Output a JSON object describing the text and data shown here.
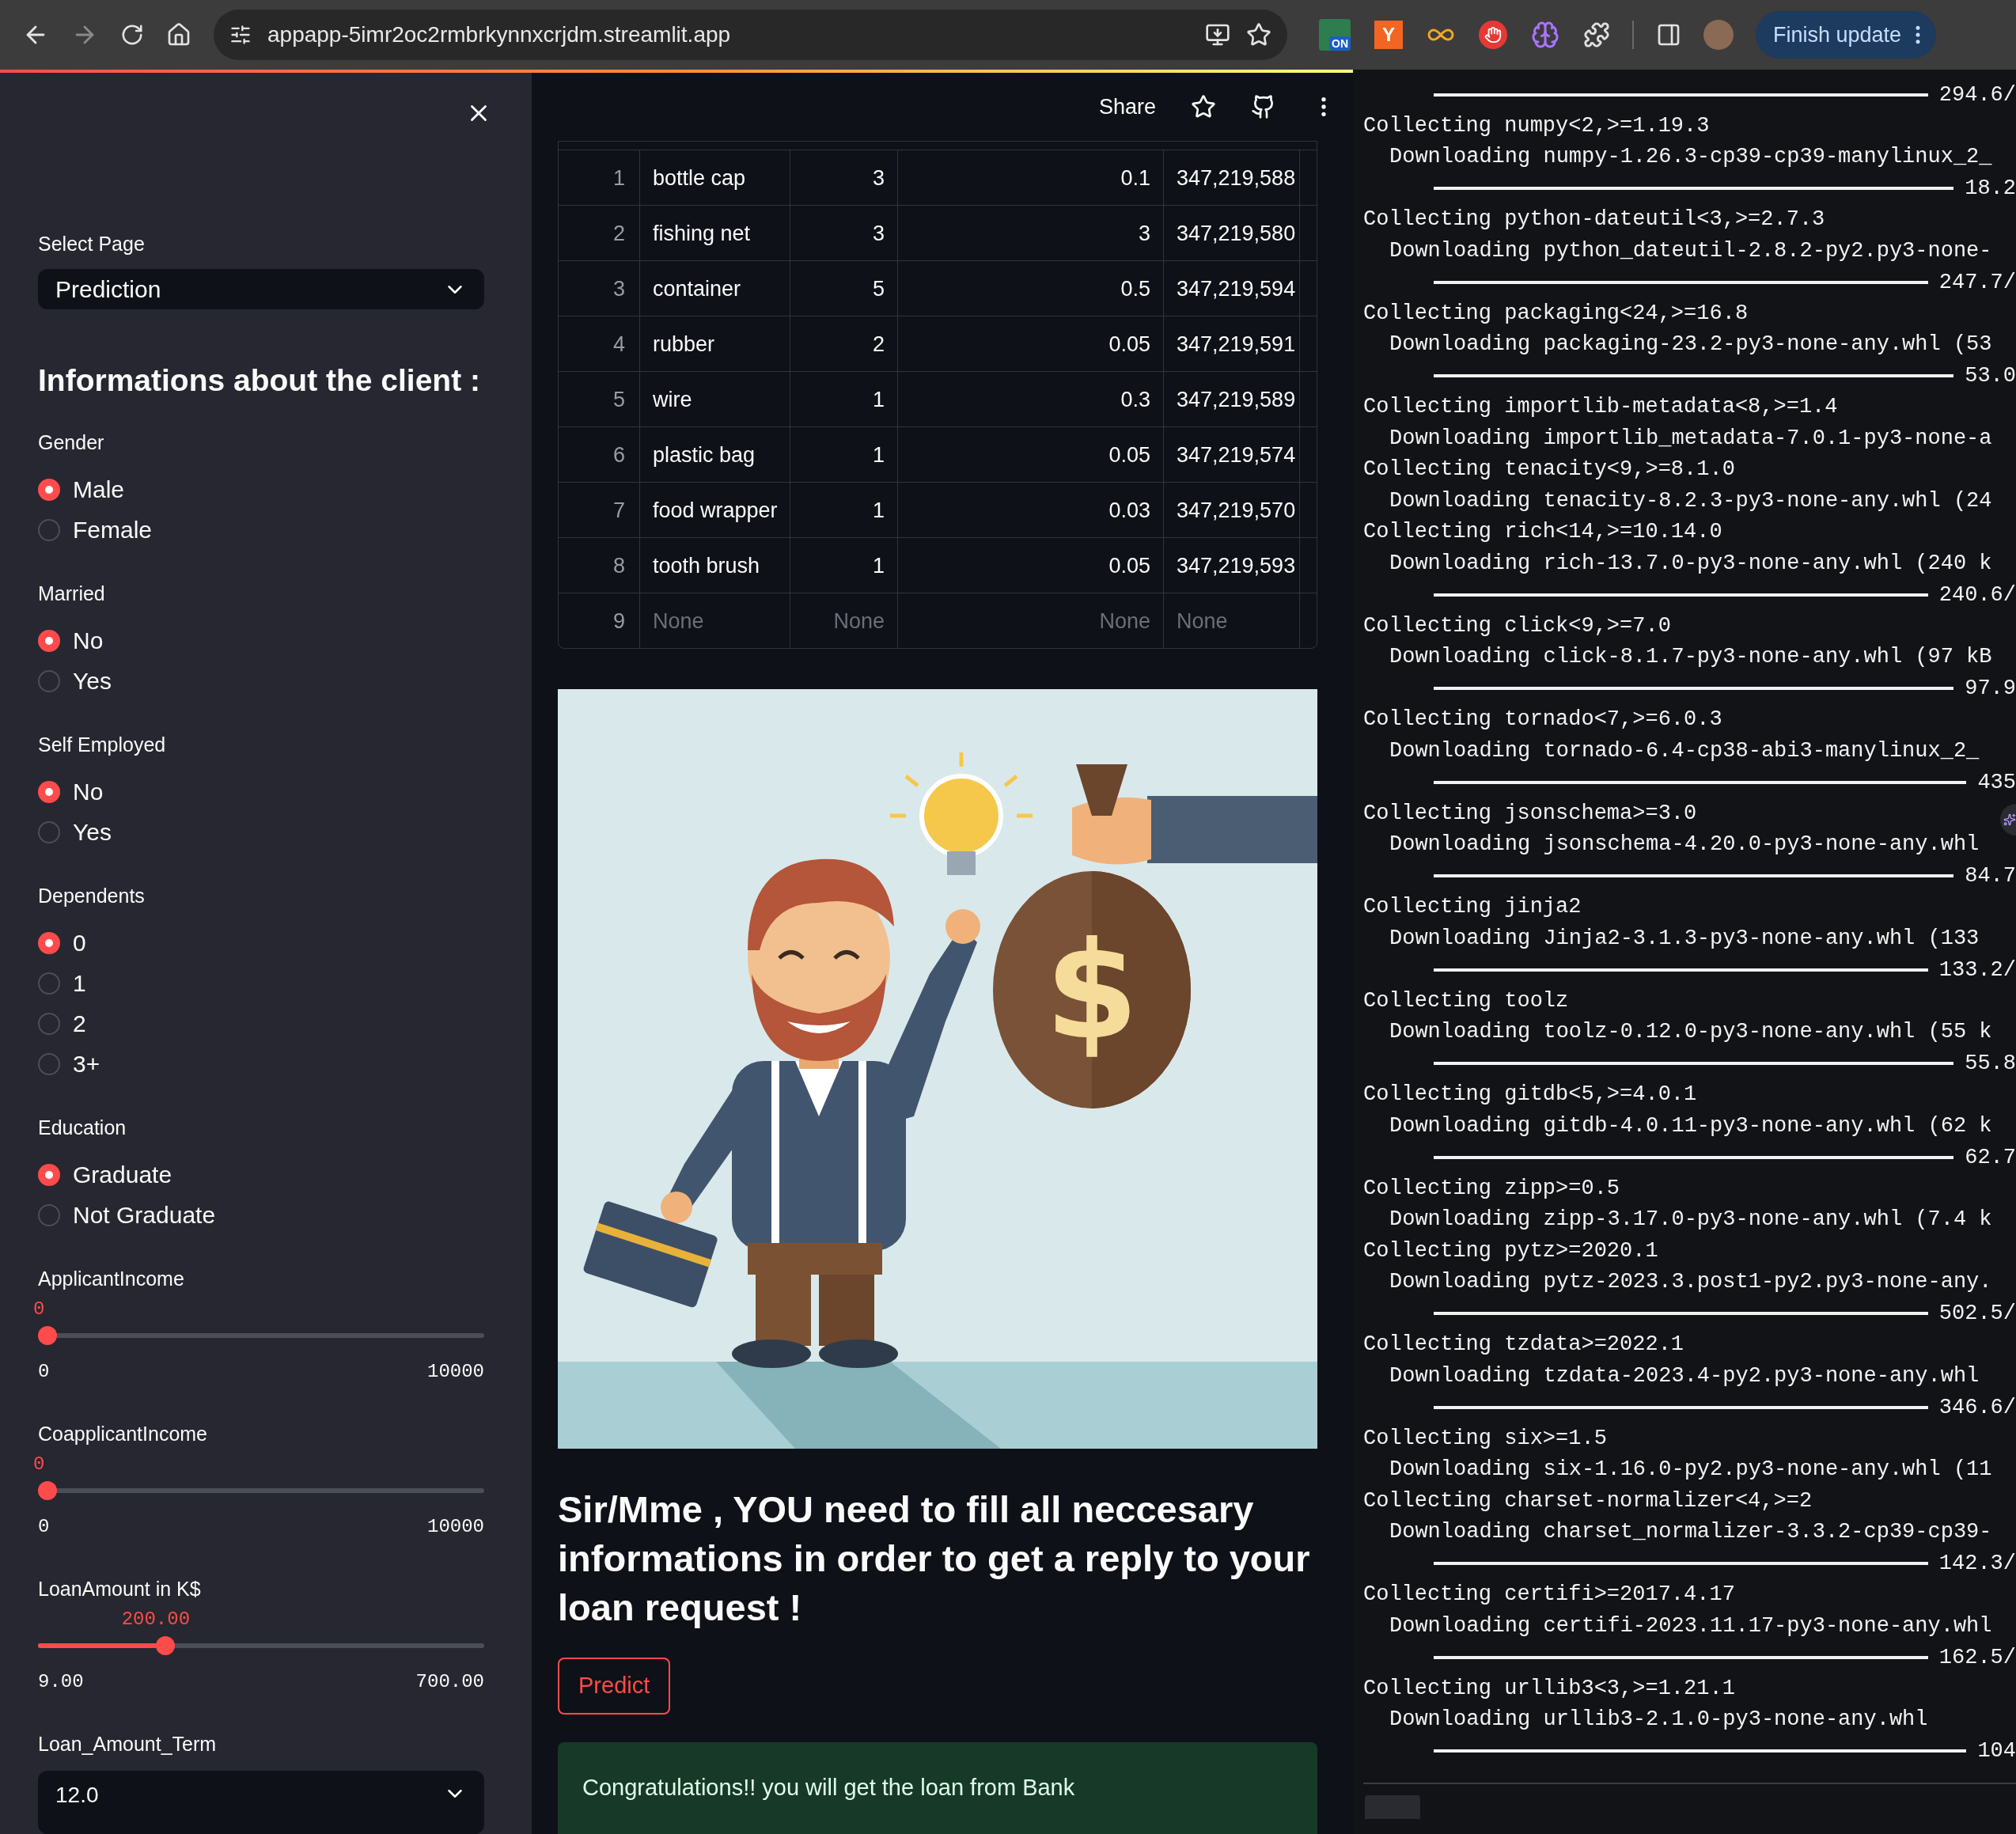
{
  "browser": {
    "url": "appapp-5imr2oc2rmbrkynnxcrjdm.streamlit.app",
    "extensions": [
      {
        "kind": "badge",
        "label": "ON"
      },
      {
        "kind": "letter",
        "label": "Y"
      },
      {
        "kind": "infinity"
      },
      {
        "kind": "hand"
      },
      {
        "kind": "brain"
      },
      {
        "kind": "puzzle"
      }
    ],
    "update_button": "Finish update"
  },
  "sidebar": {
    "select_page": {
      "label": "Select Page",
      "value": "Prediction"
    },
    "heading": "Informations about the client :",
    "radio_groups": [
      {
        "label": "Gender",
        "options": [
          {
            "label": "Male",
            "selected": true
          },
          {
            "label": "Female",
            "selected": false
          }
        ]
      },
      {
        "label": "Married",
        "options": [
          {
            "label": "No",
            "selected": true
          },
          {
            "label": "Yes",
            "selected": false
          }
        ]
      },
      {
        "label": "Self Employed",
        "options": [
          {
            "label": "No",
            "selected": true
          },
          {
            "label": "Yes",
            "selected": false
          }
        ]
      },
      {
        "label": "Dependents",
        "options": [
          {
            "label": "0",
            "selected": true
          },
          {
            "label": "1",
            "selected": false
          },
          {
            "label": "2",
            "selected": false
          },
          {
            "label": "3+",
            "selected": false
          }
        ]
      },
      {
        "label": "Education",
        "options": [
          {
            "label": "Graduate",
            "selected": true
          },
          {
            "label": "Not Graduate",
            "selected": false
          }
        ]
      }
    ],
    "sliders": [
      {
        "label": "ApplicantIncome",
        "value": "0",
        "level": 0,
        "min": "0",
        "max": "10000"
      },
      {
        "label": "CoapplicantIncome",
        "value": "0",
        "level": 0,
        "min": "0",
        "max": "10000"
      },
      {
        "label": "LoanAmount in K$",
        "value": "200.00",
        "level": 0.276,
        "min": "9.00",
        "max": "700.00"
      }
    ],
    "term_select": {
      "label": "Loan_Amount_Term",
      "value": "12.0"
    }
  },
  "toolbar": {
    "share": "Share"
  },
  "table": {
    "rows": [
      {
        "index": "1",
        "is_null": false,
        "cells": [
          "bottle cap",
          "3",
          "0.1",
          "347,219,588"
        ]
      },
      {
        "index": "2",
        "is_null": false,
        "cells": [
          "fishing net",
          "3",
          "3",
          "347,219,580"
        ]
      },
      {
        "index": "3",
        "is_null": false,
        "cells": [
          "container",
          "5",
          "0.5",
          "347,219,594"
        ]
      },
      {
        "index": "4",
        "is_null": false,
        "cells": [
          "rubber",
          "2",
          "0.05",
          "347,219,591"
        ]
      },
      {
        "index": "5",
        "is_null": false,
        "cells": [
          "wire",
          "1",
          "0.3",
          "347,219,589"
        ]
      },
      {
        "index": "6",
        "is_null": false,
        "cells": [
          "plastic bag",
          "1",
          "0.05",
          "347,219,574"
        ]
      },
      {
        "index": "7",
        "is_null": false,
        "cells": [
          "food wrapper",
          "1",
          "0.03",
          "347,219,570"
        ]
      },
      {
        "index": "8",
        "is_null": false,
        "cells": [
          "tooth brush",
          "1",
          "0.05",
          "347,219,593"
        ]
      },
      {
        "index": "9",
        "is_null": true,
        "cells": [
          "None",
          "None",
          "None",
          "None"
        ]
      }
    ]
  },
  "illustration": {
    "bag_symbol": "$"
  },
  "heading": "Sir/Mme , YOU need to fill all neccesary informations in order to get a reply to your loan request !",
  "predict_button": "Predict",
  "result": "Congratulations!! you will get the loan from Bank",
  "terminal": {
    "lines": [
      {
        "kind": "progress",
        "text": "294.6/"
      },
      {
        "kind": "collect",
        "text": "Collecting numpy<2,>=1.19.3"
      },
      {
        "kind": "download",
        "text": "Downloading numpy-1.26.3-cp39-cp39-manylinux_2_"
      },
      {
        "kind": "progress",
        "text": "18.2"
      },
      {
        "kind": "collect",
        "text": "Collecting python-dateutil<3,>=2.7.3"
      },
      {
        "kind": "download",
        "text": "Downloading python_dateutil-2.8.2-py2.py3-none-"
      },
      {
        "kind": "progress",
        "text": "247.7/"
      },
      {
        "kind": "collect",
        "text": "Collecting packaging<24,>=16.8"
      },
      {
        "kind": "download",
        "text": "Downloading packaging-23.2-py3-none-any.whl (53"
      },
      {
        "kind": "progress",
        "text": "53.0"
      },
      {
        "kind": "collect",
        "text": "Collecting importlib-metadata<8,>=1.4"
      },
      {
        "kind": "download",
        "text": "Downloading importlib_metadata-7.0.1-py3-none-a"
      },
      {
        "kind": "collect",
        "text": "Collecting tenacity<9,>=8.1.0"
      },
      {
        "kind": "download",
        "text": "Downloading tenacity-8.2.3-py3-none-any.whl (24"
      },
      {
        "kind": "collect",
        "text": "Collecting rich<14,>=10.14.0"
      },
      {
        "kind": "download",
        "text": "Downloading rich-13.7.0-py3-none-any.whl (240 k"
      },
      {
        "kind": "progress",
        "text": "240.6/"
      },
      {
        "kind": "collect",
        "text": "Collecting click<9,>=7.0"
      },
      {
        "kind": "download",
        "text": "Downloading click-8.1.7-py3-none-any.whl (97 kB"
      },
      {
        "kind": "progress",
        "text": "97.9"
      },
      {
        "kind": "collect",
        "text": "Collecting tornado<7,>=6.0.3"
      },
      {
        "kind": "download",
        "text": "Downloading tornado-6.4-cp38-abi3-manylinux_2_"
      },
      {
        "kind": "progress",
        "text": "435"
      },
      {
        "kind": "collect",
        "text": "Collecting jsonschema>=3.0"
      },
      {
        "kind": "download",
        "text": "Downloading jsonschema-4.20.0-py3-none-any.whl"
      },
      {
        "kind": "progress",
        "text": "84.7"
      },
      {
        "kind": "collect",
        "text": "Collecting jinja2"
      },
      {
        "kind": "download",
        "text": "Downloading Jinja2-3.1.3-py3-none-any.whl (133"
      },
      {
        "kind": "progress",
        "text": "133.2/"
      },
      {
        "kind": "collect",
        "text": "Collecting toolz"
      },
      {
        "kind": "download",
        "text": "Downloading toolz-0.12.0-py3-none-any.whl (55 k"
      },
      {
        "kind": "progress",
        "text": "55.8"
      },
      {
        "kind": "collect",
        "text": "Collecting gitdb<5,>=4.0.1"
      },
      {
        "kind": "download",
        "text": "Downloading gitdb-4.0.11-py3-none-any.whl (62 k"
      },
      {
        "kind": "progress",
        "text": "62.7"
      },
      {
        "kind": "collect",
        "text": "Collecting zipp>=0.5"
      },
      {
        "kind": "download",
        "text": "Downloading zipp-3.17.0-py3-none-any.whl (7.4 k"
      },
      {
        "kind": "collect",
        "text": "Collecting pytz>=2020.1"
      },
      {
        "kind": "download",
        "text": "Downloading pytz-2023.3.post1-py2.py3-none-any."
      },
      {
        "kind": "progress",
        "text": "502.5/"
      },
      {
        "kind": "collect",
        "text": "Collecting tzdata>=2022.1"
      },
      {
        "kind": "download",
        "text": "Downloading tzdata-2023.4-py2.py3-none-any.whl"
      },
      {
        "kind": "progress",
        "text": "346.6/"
      },
      {
        "kind": "collect",
        "text": "Collecting six>=1.5"
      },
      {
        "kind": "download",
        "text": "Downloading six-1.16.0-py2.py3-none-any.whl (11"
      },
      {
        "kind": "collect",
        "text": "Collecting charset-normalizer<4,>=2"
      },
      {
        "kind": "download",
        "text": "Downloading charset_normalizer-3.3.2-cp39-cp39-"
      },
      {
        "kind": "progress",
        "text": "142.3/"
      },
      {
        "kind": "collect",
        "text": "Collecting certifi>=2017.4.17"
      },
      {
        "kind": "download",
        "text": "Downloading certifi-2023.11.17-py3-none-any.whl"
      },
      {
        "kind": "progress",
        "text": "162.5/"
      },
      {
        "kind": "collect",
        "text": "Collecting urllib3<3,>=1.21.1"
      },
      {
        "kind": "download",
        "text": "Downloading urllib3-2.1.0-py3-none-any.whl"
      },
      {
        "kind": "progress",
        "text": "104"
      }
    ]
  }
}
